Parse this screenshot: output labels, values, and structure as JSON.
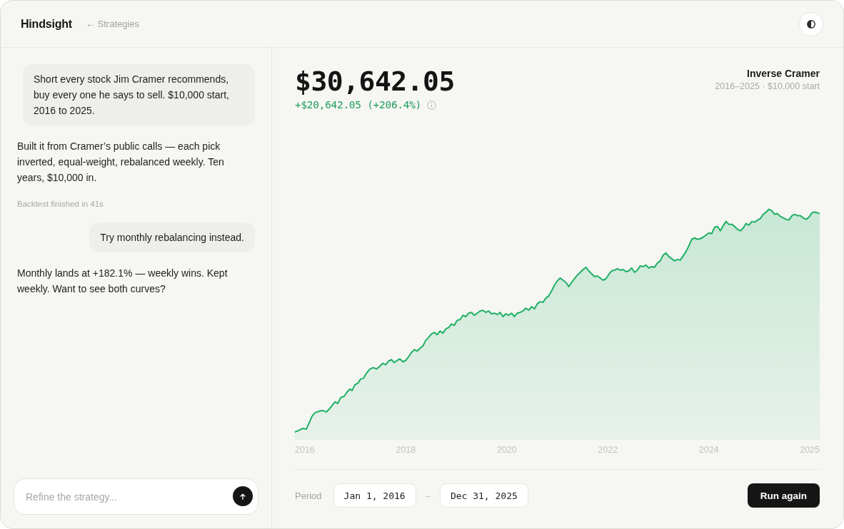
{
  "header": {
    "app_name": "Hindsight",
    "back_link": "← Strategies"
  },
  "chat": {
    "messages": [
      {
        "kind": "user",
        "text": "Short every stock Jim Cramer recommends, buy every one he says to sell. $10,000 start, 2016 to 2025."
      },
      {
        "kind": "assistant",
        "text": "Built it from Cramer’s public calls — each pick inverted, equal-weight, rebalanced weekly. Ten years, $10,000 in."
      },
      {
        "kind": "status",
        "text": "Backtest finished in 41s"
      },
      {
        "kind": "user",
        "text": "Try monthly rebalancing instead."
      },
      {
        "kind": "assistant",
        "text": "Monthly lands at +182.1% — weekly wins. Kept weekly. Want to see both curves?"
      }
    ],
    "composer": {
      "placeholder": "Refine the strategy..."
    }
  },
  "result": {
    "value": "$30,642.05",
    "change": "+$20,642.05 (+206.4%)",
    "strategy": {
      "name": "Inverse Cramer",
      "detail": "2016–2025 · $10,000 start"
    },
    "chart": {
      "x_labels": [
        "2016",
        "2018",
        "2020",
        "2022",
        "2024",
        "2025"
      ]
    },
    "period": {
      "label": "Period",
      "start": "Jan 1, 2016",
      "separator": "–",
      "end": "Dec 31, 2025"
    },
    "run_button": "Run again"
  }
}
